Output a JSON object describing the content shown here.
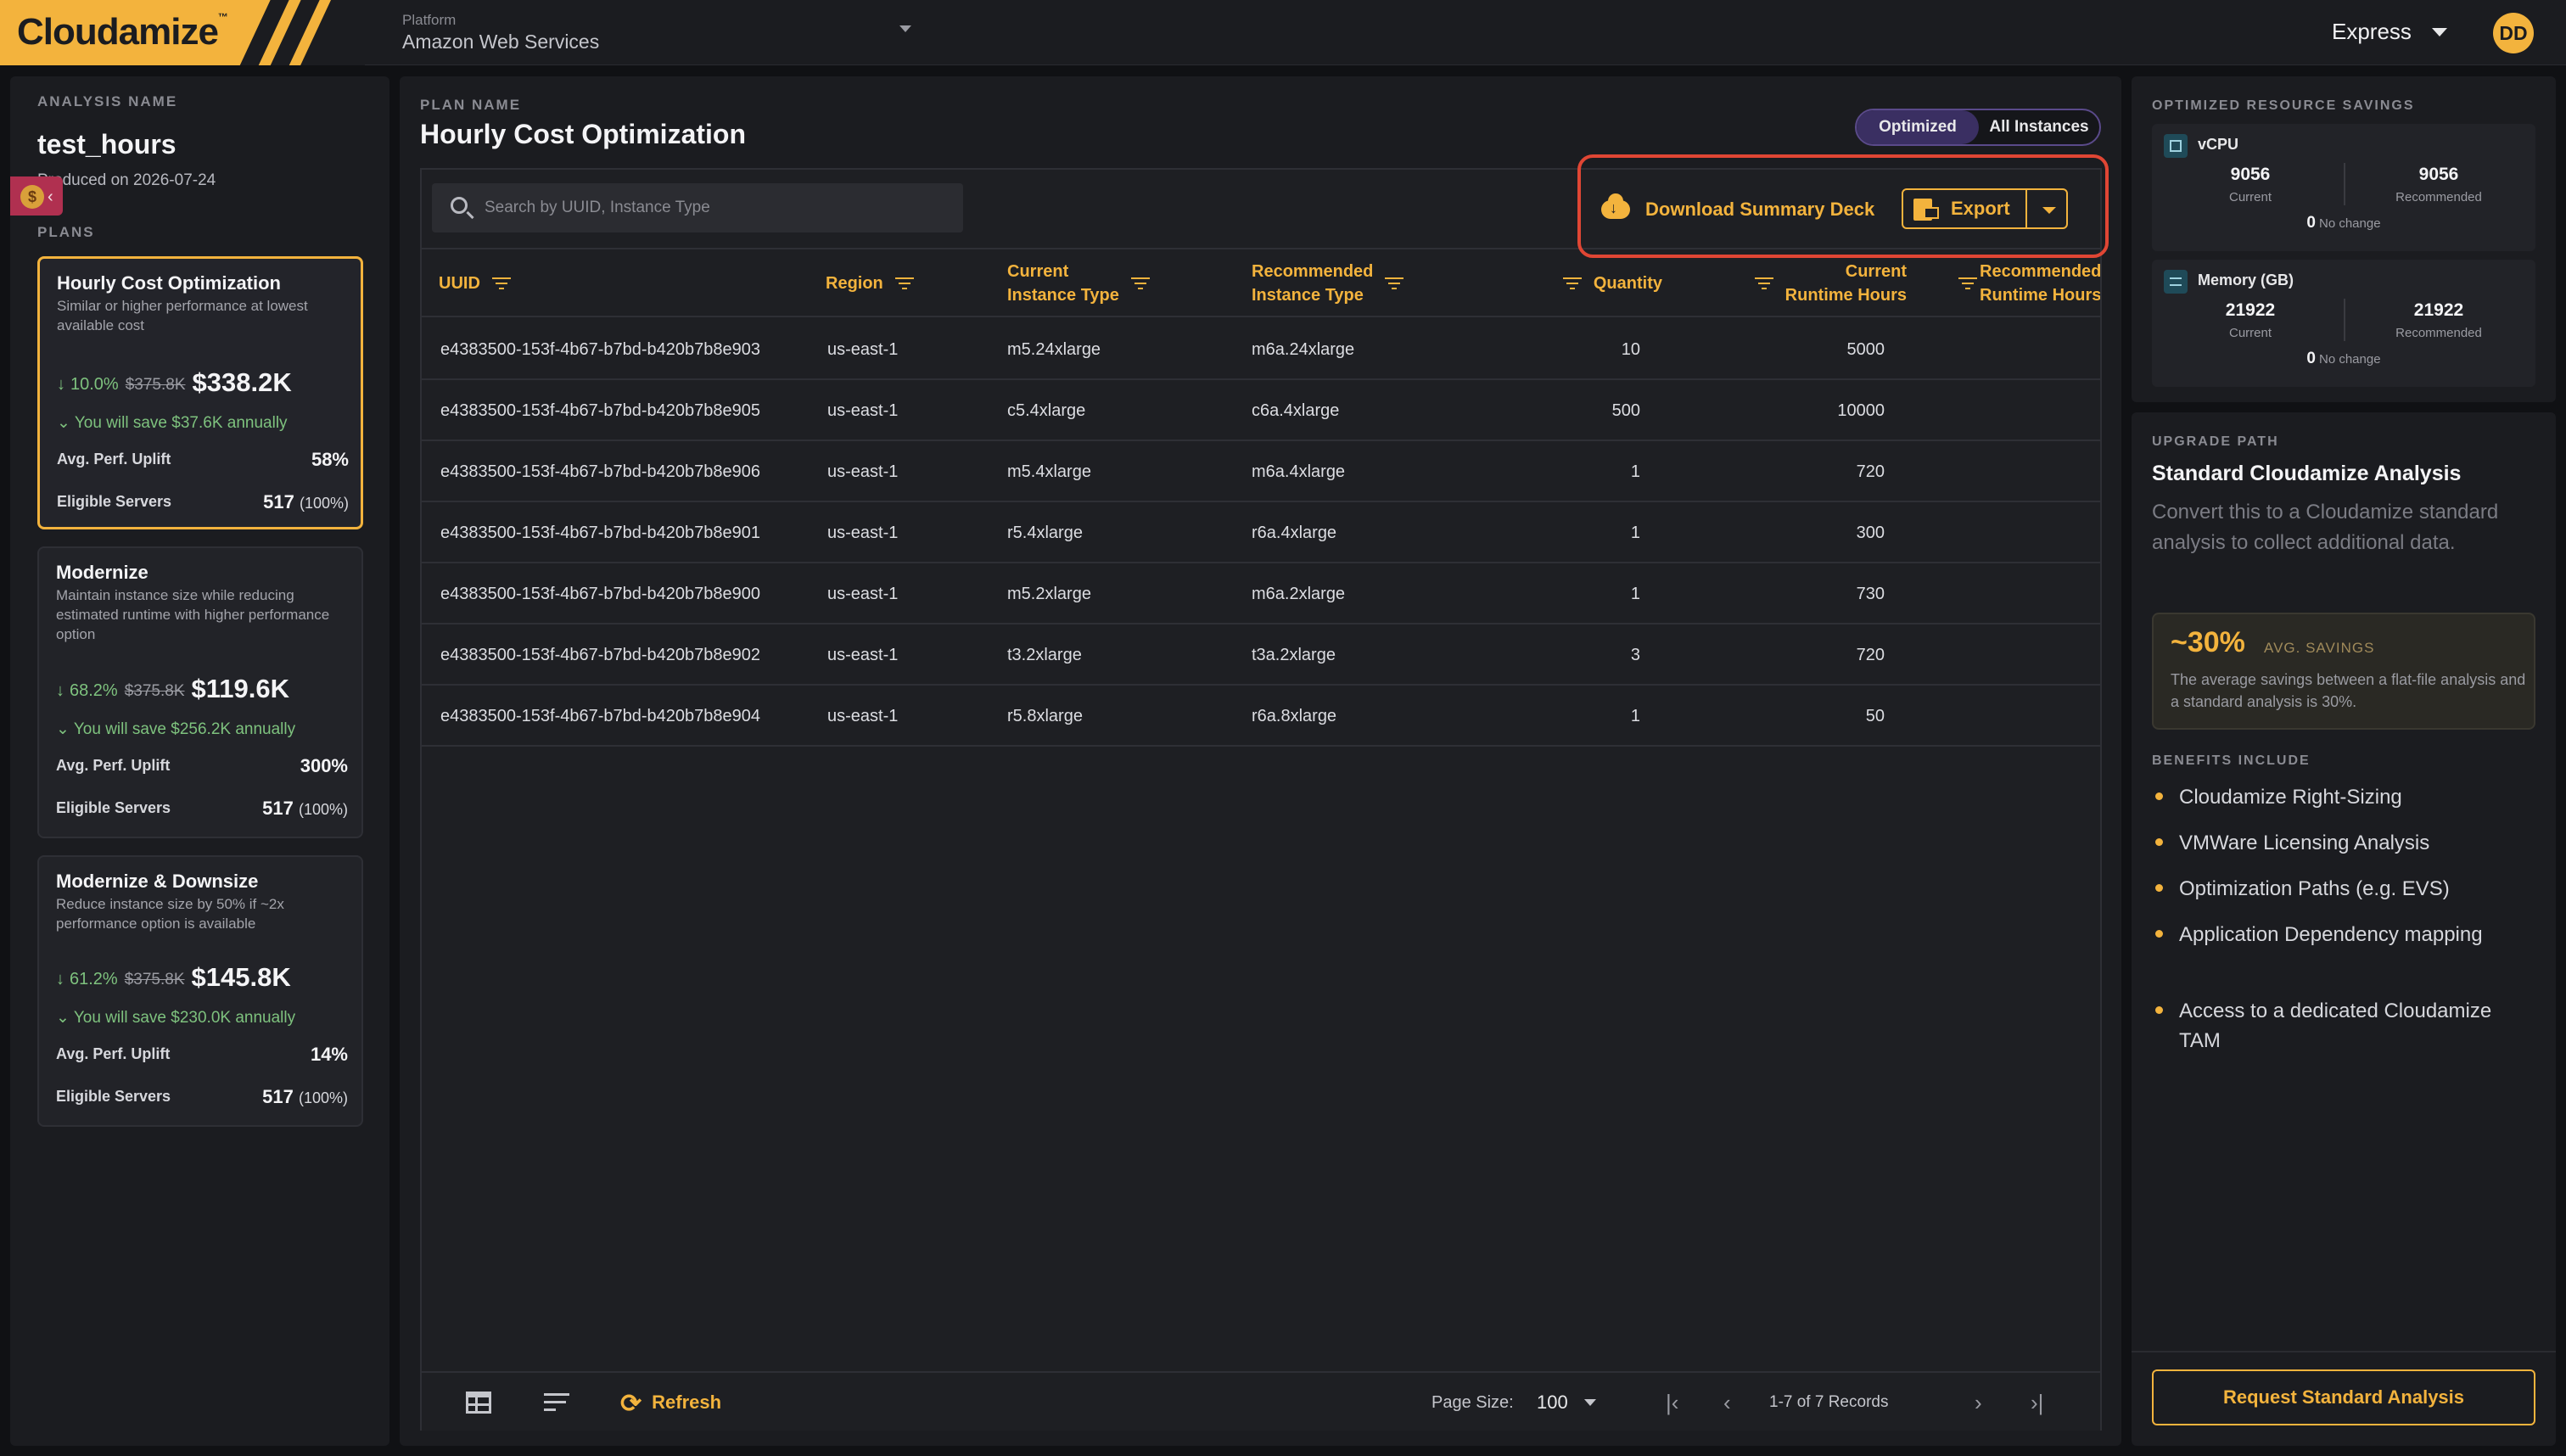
{
  "header": {
    "logo": "Cloudamize",
    "logo_tm": "™",
    "platform_label": "Platform",
    "platform_value": "Amazon Web Services",
    "tier": "Express",
    "user_initials": "DD",
    "brand_color": "#f3b33d"
  },
  "sidebar": {
    "analysis_label": "ANALYSIS NAME",
    "analysis_name": "test_hours",
    "produced_on": "Produced on 2026-07-24",
    "plans_label": "PLANS",
    "plans": [
      {
        "title": "Hourly Cost Optimization",
        "desc": "Similar or higher performance at lowest available cost",
        "pct": "10.0%",
        "old_price": "$375.8K",
        "price": "$338.2K",
        "savings": "You will save $37.6K annually",
        "perf_label": "Avg. Perf. Uplift",
        "perf_value": "58%",
        "servers_label": "Eligible Servers",
        "servers_value": "517",
        "servers_pct": "(100%)"
      },
      {
        "title": "Modernize",
        "desc": "Maintain instance size while reducing estimated runtime with higher performance option",
        "pct": "68.2%",
        "old_price": "$375.8K",
        "price": "$119.6K",
        "savings": "You will save $256.2K annually",
        "perf_label": "Avg. Perf. Uplift",
        "perf_value": "300%",
        "servers_label": "Eligible Servers",
        "servers_value": "517",
        "servers_pct": "(100%)"
      },
      {
        "title": "Modernize & Downsize",
        "desc": "Reduce instance size by 50% if ~2x performance option is available",
        "pct": "61.2%",
        "old_price": "$375.8K",
        "price": "$145.8K",
        "savings": "You will save $230.0K annually",
        "perf_label": "Avg. Perf. Uplift",
        "perf_value": "14%",
        "servers_label": "Eligible Servers",
        "servers_value": "517",
        "servers_pct": "(100%)"
      }
    ]
  },
  "main": {
    "plan_name_label": "PLAN NAME",
    "plan_title": "Hourly Cost Optimization",
    "toggle": {
      "optimized": "Optimized",
      "all": "All Instances"
    },
    "search_placeholder": "Search by UUID, Instance Type",
    "download_label": "Download Summary Deck",
    "export_label": "Export",
    "columns": {
      "uuid": "UUID",
      "region": "Region",
      "current_type": [
        "Current",
        "Instance Type"
      ],
      "recommended_type": [
        "Recommended",
        "Instance Type"
      ],
      "quantity": "Quantity",
      "current_runtime": [
        "Current",
        "Runtime Hours"
      ],
      "recommended_runtime": [
        "Recommended",
        "Runtime Hours"
      ]
    },
    "rows": [
      {
        "uuid": "e4383500-153f-4b67-b7bd-b420b7b8e903",
        "region": "us-east-1",
        "current": "m5.24xlarge",
        "recommended": "m6a.24xlarge",
        "qty": "10",
        "runtime": "5000"
      },
      {
        "uuid": "e4383500-153f-4b67-b7bd-b420b7b8e905",
        "region": "us-east-1",
        "current": "c5.4xlarge",
        "recommended": "c6a.4xlarge",
        "qty": "500",
        "runtime": "10000"
      },
      {
        "uuid": "e4383500-153f-4b67-b7bd-b420b7b8e906",
        "region": "us-east-1",
        "current": "m5.4xlarge",
        "recommended": "m6a.4xlarge",
        "qty": "1",
        "runtime": "720"
      },
      {
        "uuid": "e4383500-153f-4b67-b7bd-b420b7b8e901",
        "region": "us-east-1",
        "current": "r5.4xlarge",
        "recommended": "r6a.4xlarge",
        "qty": "1",
        "runtime": "300"
      },
      {
        "uuid": "e4383500-153f-4b67-b7bd-b420b7b8e900",
        "region": "us-east-1",
        "current": "m5.2xlarge",
        "recommended": "m6a.2xlarge",
        "qty": "1",
        "runtime": "730"
      },
      {
        "uuid": "e4383500-153f-4b67-b7bd-b420b7b8e902",
        "region": "us-east-1",
        "current": "t3.2xlarge",
        "recommended": "t3a.2xlarge",
        "qty": "3",
        "runtime": "720"
      },
      {
        "uuid": "e4383500-153f-4b67-b7bd-b420b7b8e904",
        "region": "us-east-1",
        "current": "r5.8xlarge",
        "recommended": "r6a.8xlarge",
        "qty": "1",
        "runtime": "50"
      }
    ],
    "footer": {
      "refresh": "Refresh",
      "page_size_label": "Page Size:",
      "page_size": "100",
      "records": "1-7 of 7 Records"
    }
  },
  "savings_panel": {
    "label": "OPTIMIZED RESOURCE SAVINGS",
    "resources": [
      {
        "name": "vCPU",
        "current": "9056",
        "current_label": "Current",
        "recommended": "9056",
        "recommended_label": "Recommended",
        "change": "0",
        "change_label": "No change"
      },
      {
        "name": "Memory (GB)",
        "current": "21922",
        "current_label": "Current",
        "recommended": "21922",
        "recommended_label": "Recommended",
        "change": "0",
        "change_label": "No change"
      }
    ]
  },
  "upgrade": {
    "label": "UPGRADE PATH",
    "title": "Standard Cloudamize Analysis",
    "desc": "Convert this to a Cloudamize standard analysis to collect additional data.",
    "savings_big": "~30%",
    "savings_label": "AVG. SAVINGS",
    "savings_desc": "The average savings between a flat-file analysis and a standard analysis is 30%.",
    "benefits_label": "BENEFITS INCLUDE",
    "benefits": [
      "Cloudamize Right-Sizing",
      "VMWare Licensing Analysis",
      "Optimization Paths (e.g. EVS)",
      "Application Dependency mapping",
      "Access to a dedicated Cloudamize TAM"
    ],
    "request_button": "Request Standard Analysis"
  }
}
